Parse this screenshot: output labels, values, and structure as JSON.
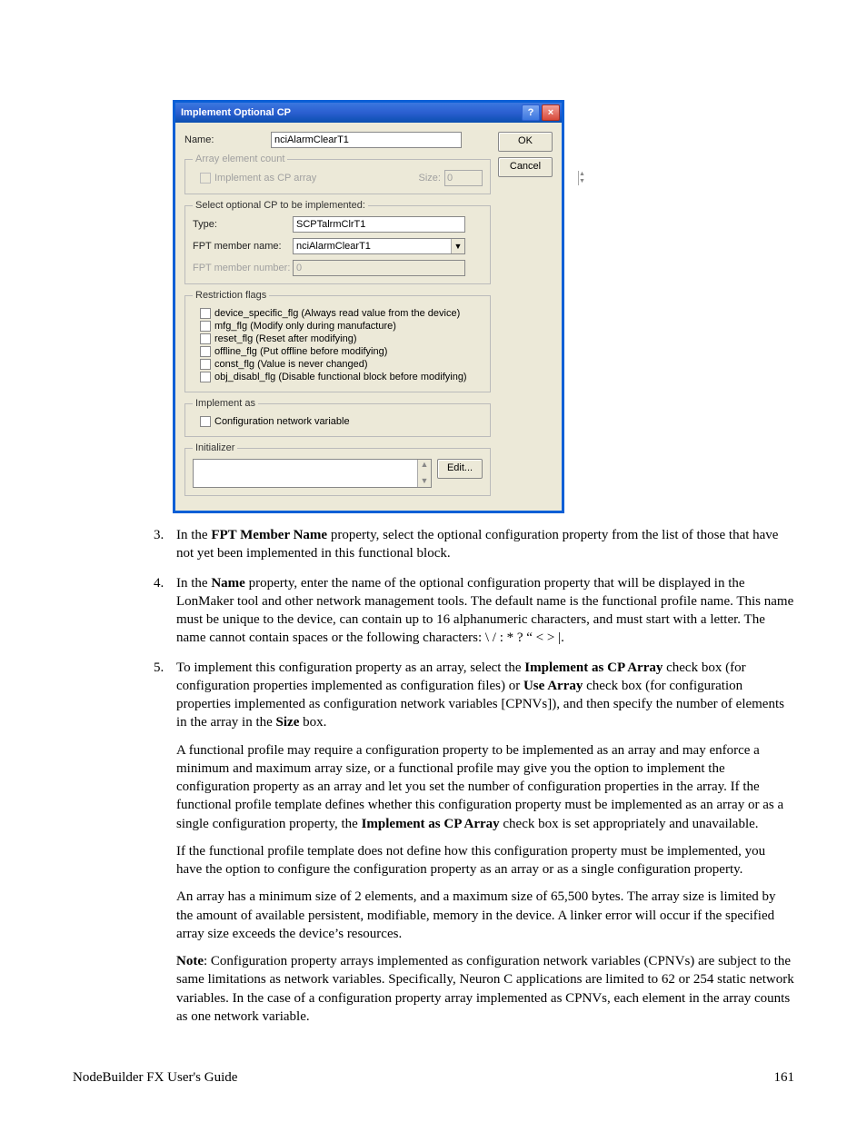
{
  "dialog": {
    "title": "Implement Optional CP",
    "buttons": {
      "ok": "OK",
      "cancel": "Cancel",
      "edit": "Edit..."
    },
    "name": {
      "label": "Name:",
      "value": "nciAlarmClearT1"
    },
    "array_group": {
      "legend": "Array element count",
      "implement_as_cp_array_label": "Implement as CP array",
      "size_label": "Size:",
      "size_value": "0"
    },
    "select_group": {
      "legend": "Select optional CP to be implemented:",
      "type_label": "Type:",
      "type_value": "SCPTalrmClrT1",
      "fpt_name_label": "FPT member name:",
      "fpt_name_value": "nciAlarmClearT1",
      "fpt_number_label": "FPT member number:",
      "fpt_number_value": "0"
    },
    "flags_group": {
      "legend": "Restriction flags",
      "items": [
        "device_specific_flg  (Always read value from the device)",
        "mfg_flg  (Modify only during manufacture)",
        "reset_flg  (Reset after modifying)",
        "offline_flg  (Put offline before modifying)",
        "const_flg  (Value is never changed)",
        "obj_disabl_flg  (Disable functional block before modifying)"
      ]
    },
    "impl_as_group": {
      "legend": "Implement as",
      "cpnv_label": "Configuration network variable"
    },
    "init_group": {
      "legend": "Initializer"
    }
  },
  "steps": {
    "s3_part1": "In the ",
    "s3_bold": "FPT Member Name",
    "s3_part2": " property, select the optional configuration property from the list of those that have not yet been implemented in this functional block.",
    "s4_part1": "In the ",
    "s4_bold": "Name",
    "s4_part2": " property, enter the name of the optional configuration property that will be displayed in the LonMaker tool and other network management tools.  The default name is the functional profile name.  This name must be unique to the device, can contain up to 16 alphanumeric characters, and must start with a letter.  The name cannot contain spaces or the following characters: \\ / : * ? “ < > |.",
    "s5_p1_a": "To implement this configuration property as an array, select the ",
    "s5_b1": "Implement as CP Array",
    "s5_p1_b": " check box (for configuration properties implemented as configuration files) or ",
    "s5_b2": "Use Array",
    "s5_p1_c": " check box (for configuration properties implemented as configuration network variables [CPNVs]), and then specify the number of elements in the array in the ",
    "s5_b3": "Size",
    "s5_p1_d": " box.",
    "s5_p2_a": "A functional profile may require a configuration property to be implemented as an array and may enforce a minimum and maximum array size, or a functional profile may give you the option to implement the configuration property as an array and let you set the number of configuration properties in the array.  If the functional profile template defines whether this configuration property must be implemented as an array or as a single configuration property, the ",
    "s5_p2_b": "Implement as CP Array",
    "s5_p2_c": " check box is set appropriately and unavailable.",
    "s5_p3": "If the functional profile template does not define how this configuration property must be implemented, you have the option to configure the configuration property as an array or as a single configuration property.",
    "s5_p4": "An array has a minimum size of 2 elements, and a maximum size of 65,500 bytes.  The array size is limited by the amount of available persistent, modifiable, memory in the device.  A linker error will occur if the specified array size exceeds the device’s resources.",
    "s5_p5_a": "Note",
    "s5_p5_b": ":  Configuration property arrays implemented as configuration network variables (CPNVs) are subject to the same limitations as network variables.  Specifically, Neuron C applications are limited to 62 or 254 static network variables.  In the case of a configuration property array implemented as CPNVs, each element in the array counts as one network variable."
  },
  "footer": {
    "left": "NodeBuilder FX User's Guide",
    "right": "161"
  }
}
